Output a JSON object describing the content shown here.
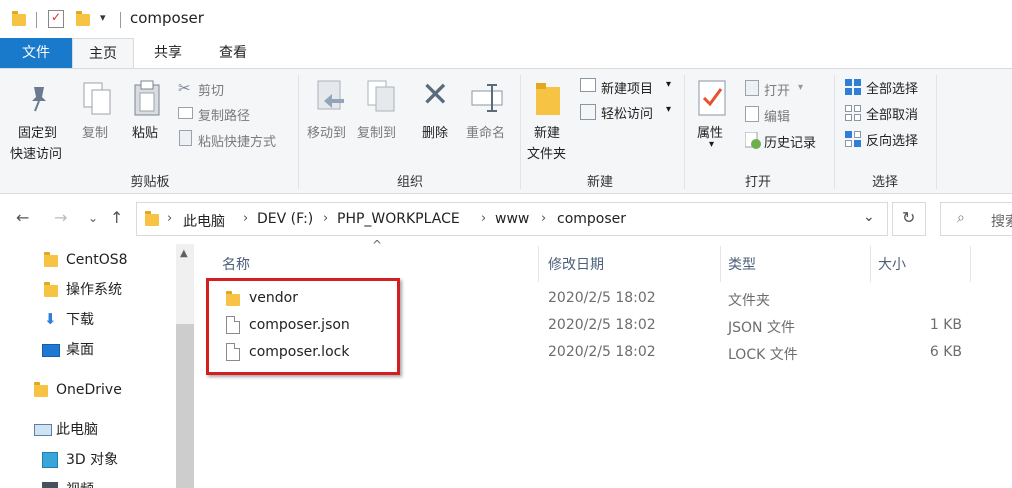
{
  "window": {
    "title": "composer"
  },
  "tabs": [
    "文件",
    "主页",
    "共享",
    "查看"
  ],
  "ribbon": {
    "clipboard": {
      "title": "剪贴板",
      "pin_line1": "固定到",
      "pin_line2": "快速访问",
      "copy": "复制",
      "paste": "粘贴",
      "cut": "剪切",
      "copy_path": "复制路径",
      "paste_shortcut": "粘贴快捷方式"
    },
    "organize": {
      "title": "组织",
      "move_to": "移动到",
      "copy_to": "复制到",
      "delete": "删除",
      "rename": "重命名"
    },
    "new": {
      "title": "新建",
      "new_folder_line1": "新建",
      "new_folder_line2": "文件夹",
      "new_item": "新建项目",
      "easy_access": "轻松访问"
    },
    "open": {
      "title": "打开",
      "properties": "属性",
      "open": "打开",
      "edit": "编辑",
      "history": "历史记录"
    },
    "select": {
      "title": "选择",
      "select_all": "全部选择",
      "select_none": "全部取消",
      "invert": "反向选择"
    }
  },
  "address": {
    "crumbs": [
      "此电脑",
      "DEV (F:)",
      "PHP_WORKPLACE",
      "www",
      "composer"
    ],
    "search_placeholder": "搜索"
  },
  "navpane": {
    "items": [
      "CentOS8",
      "操作系统",
      "下载",
      "桌面",
      "OneDrive",
      "此电脑",
      "3D 对象",
      "视频"
    ]
  },
  "list": {
    "headers": {
      "name": "名称",
      "date": "修改日期",
      "type": "类型",
      "size": "大小"
    },
    "rows": [
      {
        "name": "vendor",
        "date": "2020/2/5 18:02",
        "type": "文件夹",
        "size": ""
      },
      {
        "name": "composer.json",
        "date": "2020/2/5 18:02",
        "type": "JSON 文件",
        "size": "1 KB"
      },
      {
        "name": "composer.lock",
        "date": "2020/2/5 18:02",
        "type": "LOCK 文件",
        "size": "6 KB"
      }
    ]
  },
  "colors": {
    "accent": "#1979ca",
    "highlight": "#d21f1f",
    "folder": "#f6c344"
  }
}
